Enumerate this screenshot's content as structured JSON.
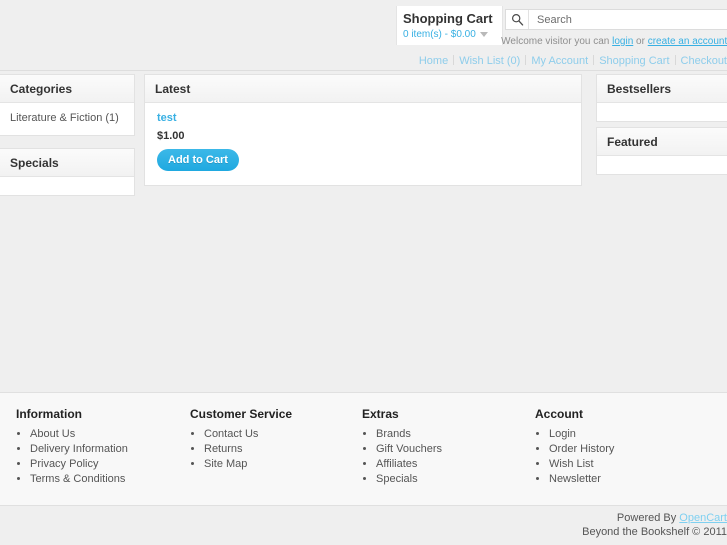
{
  "header": {
    "cart": {
      "title": "Shopping Cart",
      "summary": "0 item(s) - $0.00",
      "caret_icon": "chevron-down-icon"
    },
    "search": {
      "placeholder": "Search",
      "value": "",
      "icon": "search-icon"
    },
    "welcome": {
      "prefix": "Welcome visitor you can ",
      "login_label": "login",
      "middle": " or ",
      "register_label": "create an account",
      "suffix": "."
    },
    "nav": [
      {
        "label": "Home"
      },
      {
        "label": "Wish List (0)"
      },
      {
        "label": "My Account"
      },
      {
        "label": "Shopping Cart"
      },
      {
        "label": "Checkout"
      }
    ]
  },
  "left_column": {
    "categories": {
      "heading": "Categories",
      "items": [
        {
          "label": "Literature & Fiction (1)"
        }
      ]
    },
    "specials": {
      "heading": "Specials",
      "items": []
    }
  },
  "content": {
    "latest": {
      "heading": "Latest",
      "products": [
        {
          "name": "test",
          "price": "$1.00",
          "button_label": "Add to Cart"
        }
      ]
    }
  },
  "right_column": {
    "bestsellers": {
      "heading": "Bestsellers",
      "items": []
    },
    "featured": {
      "heading": "Featured",
      "items": []
    }
  },
  "footer": {
    "columns": [
      {
        "title": "Information",
        "links": [
          {
            "label": "About Us"
          },
          {
            "label": "Delivery Information"
          },
          {
            "label": "Privacy Policy"
          },
          {
            "label": "Terms & Conditions"
          }
        ]
      },
      {
        "title": "Customer Service",
        "links": [
          {
            "label": "Contact Us"
          },
          {
            "label": "Returns"
          },
          {
            "label": "Site Map"
          }
        ]
      },
      {
        "title": "Extras",
        "links": [
          {
            "label": "Brands"
          },
          {
            "label": "Gift Vouchers"
          },
          {
            "label": "Affiliates"
          },
          {
            "label": "Specials"
          }
        ]
      },
      {
        "title": "Account",
        "links": [
          {
            "label": "Login"
          },
          {
            "label": "Order History"
          },
          {
            "label": "Wish List"
          },
          {
            "label": "Newsletter"
          }
        ]
      }
    ],
    "powered_prefix": "Powered By ",
    "powered_link": "OpenCart",
    "copyright": "Beyond the Bookshelf © 2011"
  },
  "colors": {
    "accent": "#38B0E3",
    "page_bg": "#efefef",
    "panel_bg": "#ffffff",
    "footer_bg": "#f8f8f8",
    "border": "#e2e2e2",
    "nav_link": "#8ecdeb"
  }
}
